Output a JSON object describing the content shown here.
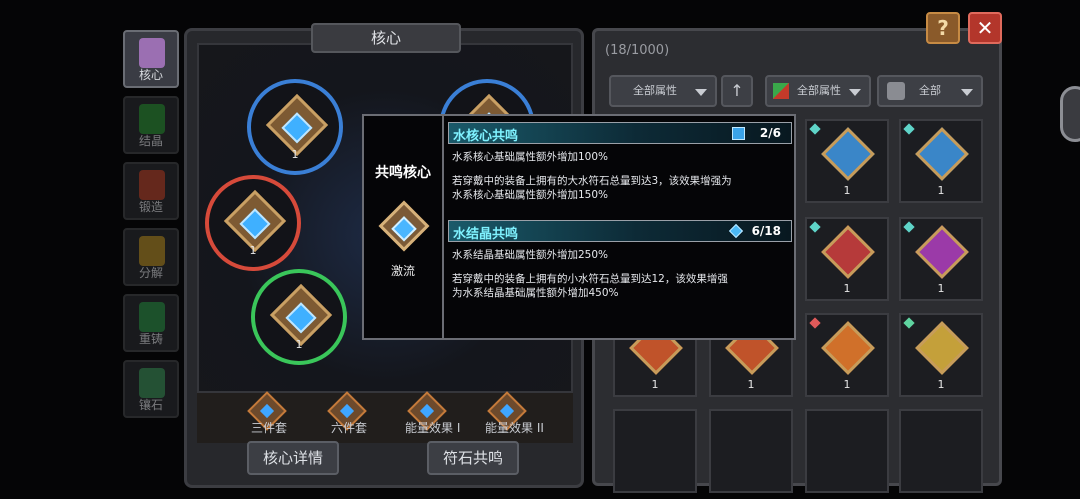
{
  "side_tabs": [
    {
      "label": "核心",
      "active": true,
      "color": "#9b6fb2"
    },
    {
      "label": "结晶",
      "active": false,
      "color": "#2f8f3a"
    },
    {
      "label": "锻造",
      "active": false,
      "color": "#b5452f"
    },
    {
      "label": "分解",
      "active": false,
      "color": "#b08a2a"
    },
    {
      "label": "重铸",
      "active": false,
      "color": "#2f8f4a"
    },
    {
      "label": "镶石",
      "active": false,
      "color": "#3f8f5a"
    }
  ],
  "core_panel": {
    "title": "核心",
    "slots": [
      {
        "count": "1",
        "ring_color": "#3a7fd6"
      },
      {
        "count": "1",
        "ring_color": "#3a7fd6"
      },
      {
        "count": "1",
        "ring_color": "#d64a3a"
      },
      {
        "count": "1",
        "ring_color": "#3ac65a"
      }
    ],
    "set_labels": [
      "三件套",
      "六件套",
      "能量效果 I",
      "能量效果 II"
    ],
    "buttons": {
      "detail": "核心详情",
      "resonance": "符石共鸣"
    }
  },
  "inventory": {
    "count_label": "(18/1000)",
    "filters": {
      "attribute": "全部属性",
      "element": "全部属性",
      "type": "全部"
    },
    "rows": [
      [
        {
          "count": "1",
          "gem": "#3a86c8",
          "pip": "#5fd4c8"
        },
        {
          "count": "1",
          "gem": "#3a86c8",
          "pip": "#5fd4c8"
        }
      ],
      [
        {
          "count": "1",
          "gem": "#b63a3a",
          "pip": "#5fd4c8"
        },
        {
          "count": "1",
          "gem": "#9b3aa8",
          "pip": "#5fd4c8"
        }
      ],
      [
        {
          "count": "1",
          "gem": "#c0532a",
          "pip": ""
        },
        {
          "count": "1",
          "gem": "#c0532a",
          "pip": ""
        },
        {
          "count": "1",
          "gem": "#d0702a",
          "pip": "#e05a5a"
        },
        {
          "count": "1",
          "gem": "#c4a03a",
          "pip": "#5fd4a0"
        }
      ]
    ]
  },
  "tooltip": {
    "title": "共鸣核心",
    "core_name": "激流",
    "sections": [
      {
        "name": "水核心共鸣",
        "progress": "2/6",
        "lines": [
          "水系核心基础属性额外增加100%"
        ],
        "lines2": [
          "若穿戴中的装备上拥有的大水符石总量到达3，该效果增强为",
          "水系核心基础属性额外增加150%"
        ]
      },
      {
        "name": "水结晶共鸣",
        "progress": "6/18",
        "lines": [
          "水系结晶基础属性额外增加250%"
        ],
        "lines2": [
          "若穿戴中的装备上拥有的小水符石总量到达12，该效果增强",
          "为水系结晶基础属性额外增加450%"
        ]
      }
    ]
  },
  "icons": {
    "help": "?",
    "close": "✕"
  },
  "accent": "#7ff2ff"
}
